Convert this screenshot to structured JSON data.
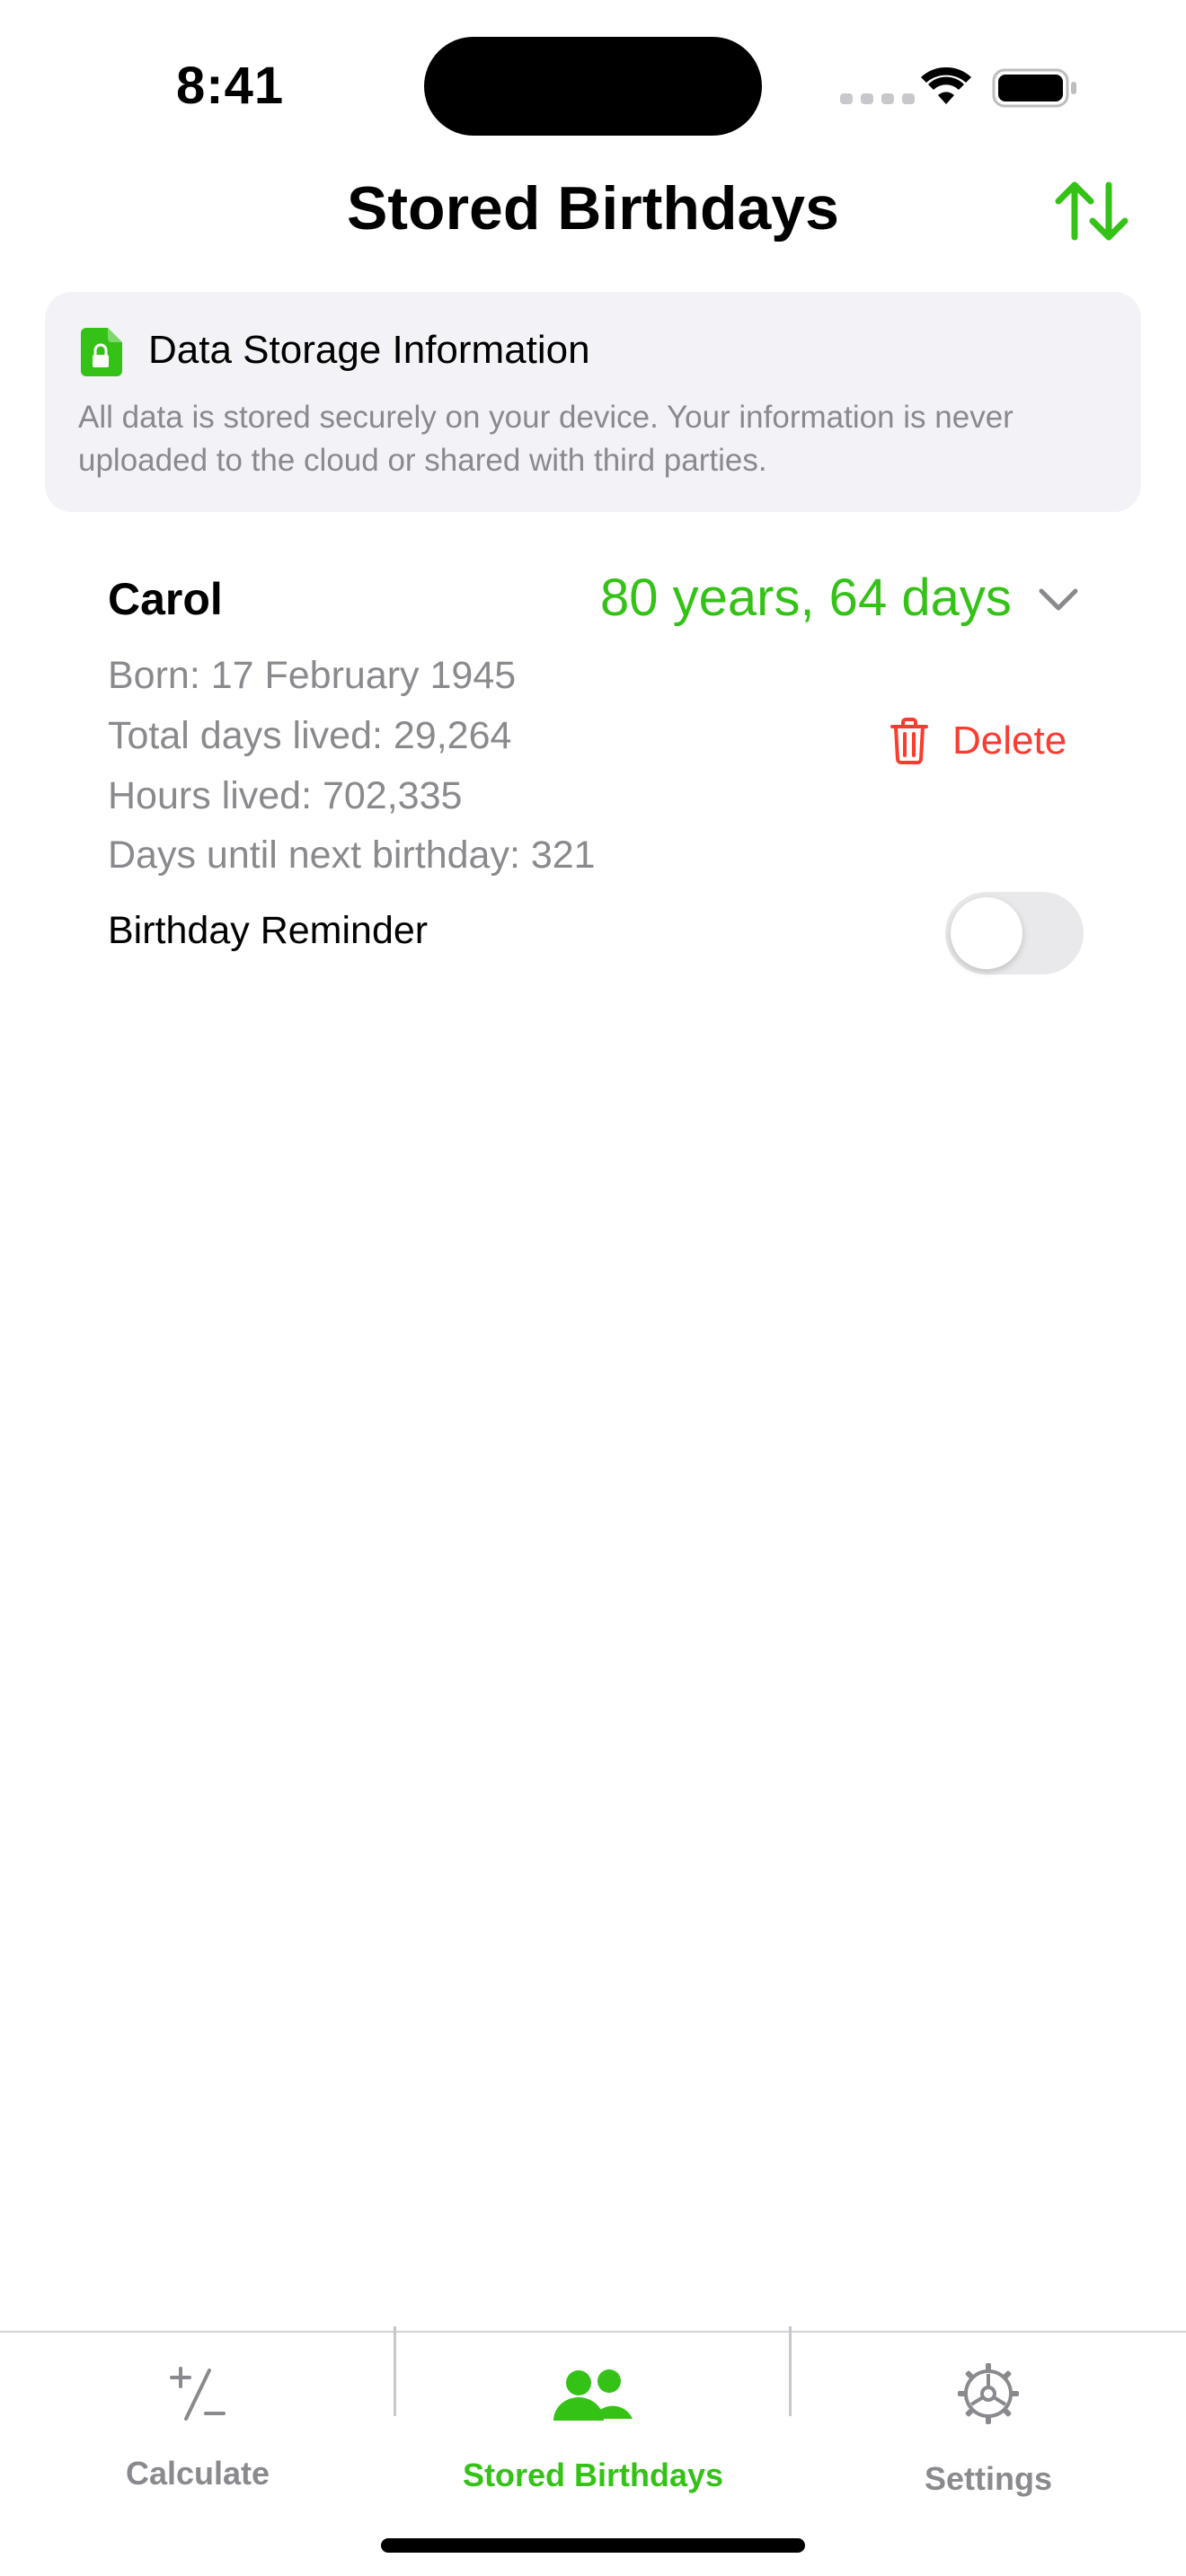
{
  "status_bar": {
    "time": "8:41"
  },
  "nav": {
    "title": "Stored Birthdays",
    "sort_icon": "arrow-up-down-icon"
  },
  "info_card": {
    "icon": "lock-document-icon",
    "title": "Data Storage Information",
    "body": "All data is stored securely on your device. Your information is never uploaded to the cloud or shared with third parties."
  },
  "entry": {
    "name": "Carol",
    "age": "80 years, 64 days",
    "born": "Born: 17 February 1945",
    "total_days": "Total days lived: 29,264",
    "hours": "Hours lived: 702,335",
    "days_until": "Days until next birthday: 321",
    "delete_label": "Delete",
    "reminder_label": "Birthday Reminder",
    "reminder_on": false
  },
  "tabs": [
    {
      "label": "Calculate",
      "icon": "plus-minus-icon",
      "active": false
    },
    {
      "label": "Stored Birthdays",
      "icon": "people-icon",
      "active": true
    },
    {
      "label": "Settings",
      "icon": "gear-icon",
      "active": false
    }
  ],
  "colors": {
    "accent": "#34C217",
    "destructive": "#FF3B30",
    "secondary_text": "#8A8A8E",
    "card_background": "#F2F2F7"
  }
}
